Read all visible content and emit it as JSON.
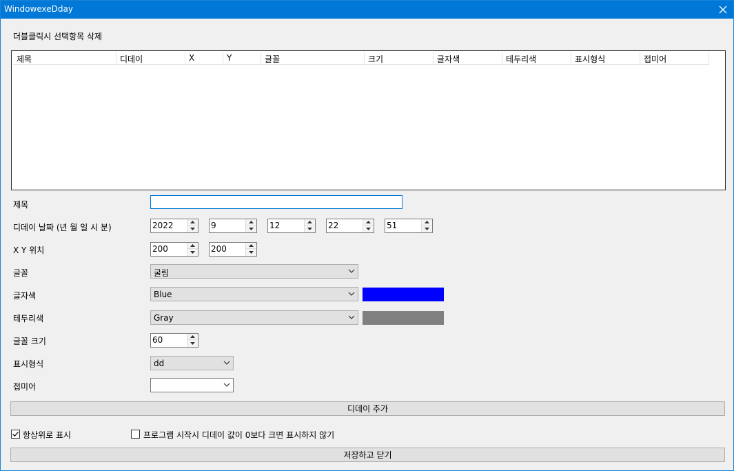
{
  "window": {
    "title": "WindowexeDday"
  },
  "hint": "더블클릭시 선택항목 삭제",
  "list": {
    "columns": [
      "제목",
      "디데이",
      "X",
      "Y",
      "글꼴",
      "크기",
      "글자색",
      "테두리색",
      "표시형식",
      "접미어"
    ]
  },
  "form": {
    "title_label": "제목",
    "title_value": "",
    "date_label": "디데이 날짜 (년 월 일 시 분)",
    "year": "2022",
    "month": "9",
    "day": "12",
    "hour": "22",
    "minute": "51",
    "pos_label": "X Y 위치",
    "x": "200",
    "y": "200",
    "font_label": "글꼴",
    "font_value": "굴림",
    "fg_label": "글자색",
    "fg_value": "Blue",
    "fg_color": "#0000ff",
    "border_label": "테두리색",
    "border_value": "Gray",
    "border_color": "#808080",
    "size_label": "글꼴 크기",
    "size_value": "60",
    "format_label": "표시형식",
    "format_value": "dd",
    "suffix_label": "접미어",
    "suffix_value": ""
  },
  "buttons": {
    "add": "디데이 추가",
    "save_close": "저장하고 닫기"
  },
  "options": {
    "topmost_label": "항상위로 표시",
    "topmost_checked": true,
    "hide_label": "프로그램 시작시 디데이 값이 0보다 크면 표시하지 않기",
    "hide_checked": false
  }
}
